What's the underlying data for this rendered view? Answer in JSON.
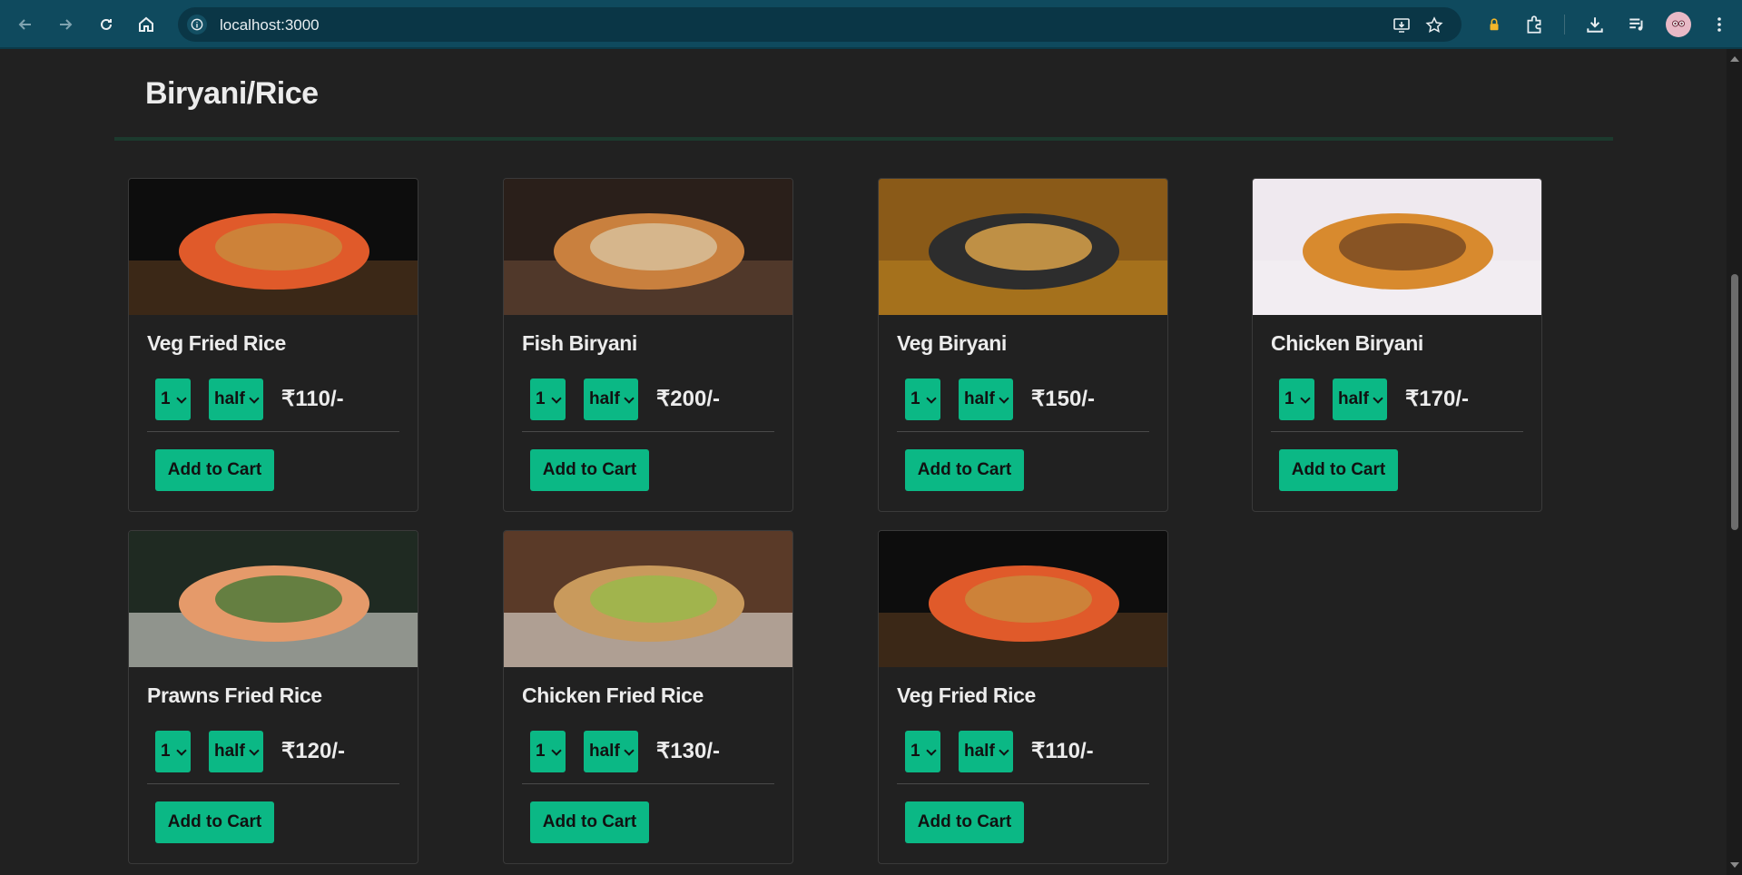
{
  "browser": {
    "url": "localhost:3000"
  },
  "section": {
    "title": "Biryani/Rice"
  },
  "items": [
    {
      "name": "Veg Fried Rice",
      "qty": "1",
      "size": "half",
      "price": "₹110/-",
      "button": "Add to Cart",
      "img": {
        "c1": "#0d0d0d",
        "c2": "#5a3a1e",
        "c3": "#e05a2a",
        "c4": "#c98a3c"
      }
    },
    {
      "name": "Fish Biryani",
      "qty": "1",
      "size": "half",
      "price": "₹200/-",
      "button": "Add to Cart",
      "img": {
        "c1": "#2a1f1a",
        "c2": "#6b4a36",
        "c3": "#c9803e",
        "c4": "#d8c09a"
      }
    },
    {
      "name": "Veg Biryani",
      "qty": "1",
      "size": "half",
      "price": "₹150/-",
      "button": "Add to Cart",
      "img": {
        "c1": "#8a5a18",
        "c2": "#b8801f",
        "c3": "#2d2d2d",
        "c4": "#d9a24a"
      }
    },
    {
      "name": "Chicken Biryani",
      "qty": "1",
      "size": "half",
      "price": "₹170/-",
      "button": "Add to Cart",
      "img": {
        "c1": "#efe9ef",
        "c2": "#f4f0f4",
        "c3": "#d88a2e",
        "c4": "#7a4a22"
      }
    },
    {
      "name": "Prawns Fried Rice",
      "qty": "1",
      "size": "half",
      "price": "₹120/-",
      "button": "Add to Cart",
      "img": {
        "c1": "#1f2a22",
        "c2": "#dcdcd6",
        "c3": "#e59a6a",
        "c4": "#4f7a3a"
      }
    },
    {
      "name": "Chicken Fried Rice",
      "qty": "1",
      "size": "half",
      "price": "₹130/-",
      "button": "Add to Cart",
      "img": {
        "c1": "#5a3a28",
        "c2": "#e8e2da",
        "c3": "#c99a5c",
        "c4": "#9ab84a"
      }
    },
    {
      "name": "Veg Fried Rice",
      "qty": "1",
      "size": "half",
      "price": "₹110/-",
      "button": "Add to Cart",
      "img": {
        "c1": "#0d0d0d",
        "c2": "#5a3a1e",
        "c3": "#e05a2a",
        "c4": "#c98a3c"
      }
    }
  ]
}
